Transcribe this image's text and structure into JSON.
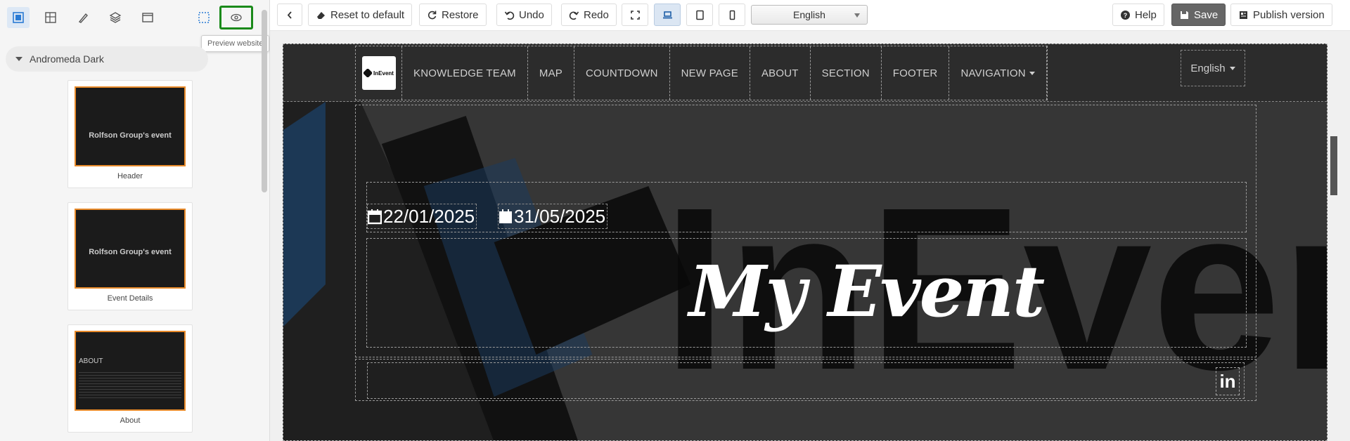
{
  "sidebar": {
    "tooltip": "Preview website",
    "theme_name": "Andromeda Dark",
    "cards": [
      {
        "caption": "Header",
        "thumb_title": "Rolfson Group's event"
      },
      {
        "caption": "Event Details",
        "thumb_title": "Rolfson Group's event"
      },
      {
        "caption": "About",
        "thumb_title": "ABOUT"
      }
    ]
  },
  "toolbar": {
    "reset_label": "Reset to default",
    "restore_label": "Restore",
    "undo_label": "Undo",
    "redo_label": "Redo",
    "language_select": "English",
    "help_label": "Help",
    "save_label": "Save",
    "publish_label": "Publish version"
  },
  "site": {
    "logo_text": "InEvent",
    "nav": [
      "KNOWLEDGE TEAM",
      "MAP",
      "COUNTDOWN",
      "NEW PAGE",
      "ABOUT",
      "SECTION",
      "FOOTER",
      "NAVIGATION"
    ],
    "language": "English",
    "start_date": "22/01/2025",
    "end_date": "31/05/2025",
    "event_title": "My Event",
    "social_icon": "in",
    "background_watermark": "InEver"
  },
  "colors": {
    "accent": "#e88a2a",
    "preview_highlight": "#1a8a1a",
    "canvas_bg": "#363636",
    "save_button": "#666666"
  }
}
